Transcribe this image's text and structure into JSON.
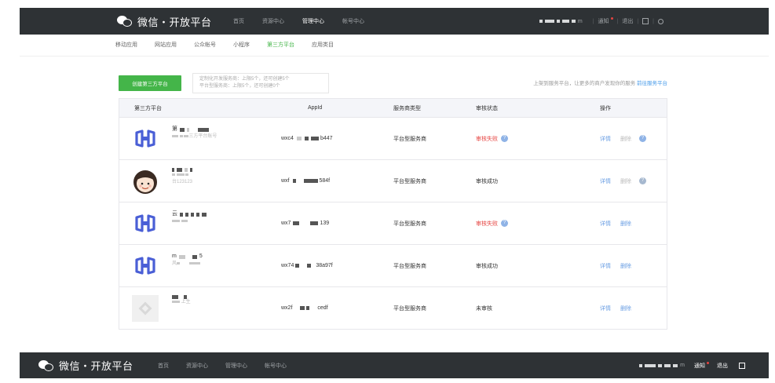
{
  "header": {
    "logo_text": "微信・开放平台",
    "nav": [
      "首页",
      "资源中心",
      "管理中心",
      "帐号中心"
    ],
    "active_nav": "管理中心",
    "account_suffix": "m",
    "notify": "通知",
    "logout": "退出"
  },
  "subnav": {
    "items": [
      "移动应用",
      "网站应用",
      "公众帐号",
      "小程序",
      "第三方平台",
      "应用类目"
    ],
    "active": "第三方平台"
  },
  "actions": {
    "create_button": "创建第三方平台",
    "quota_line1": "定制化开发服务商：上限5个，还可创建5个",
    "quota_line2": "平台型服务商：上限5个，还可创建0个",
    "notice_text": "上架到服务平台，让更多的商户发现你的服务",
    "notice_link": "前往服务平台"
  },
  "table": {
    "headers": {
      "platform": "第三方平台",
      "appid": "AppId",
      "type": "服务商类型",
      "status": "审核状态",
      "op": "操作"
    },
    "rows": [
      {
        "name": "第",
        "desc": "三方平台账号",
        "appid": "wxc4",
        "appid_tail": "b447",
        "type": "平台型服务商",
        "status": "审核失败",
        "status_type": "fail",
        "op_detail": "详情",
        "op_delete": "删除",
        "avatar": "bracket-logo",
        "delete_enabled": false
      },
      {
        "name": "",
        "desc": "台123123",
        "appid": "wxf",
        "appid_tail": "584f",
        "type": "平台型服务商",
        "status": "审核成功",
        "status_type": "ok",
        "op_detail": "详情",
        "op_delete": "删除",
        "avatar": "cartoon-face",
        "delete_enabled": false
      },
      {
        "name": "云",
        "desc": "",
        "appid": "wx7",
        "appid_tail": "139",
        "type": "平台型服务商",
        "status": "审核失败",
        "status_type": "fail",
        "op_detail": "详情",
        "op_delete": "删除",
        "avatar": "bracket-logo",
        "delete_enabled": true
      },
      {
        "name": "m",
        "name_tail": "5",
        "desc": "风",
        "appid": "wx74",
        "appid_tail": "38a97f",
        "type": "平台型服务商",
        "status": "审核成功",
        "status_type": "ok",
        "op_detail": "详情",
        "op_delete": "删除",
        "avatar": "bracket-logo",
        "delete_enabled": true
      },
      {
        "name": "",
        "desc": "上生",
        "appid": "wx2f",
        "appid_tail": "cedf",
        "type": "平台型服务商",
        "status": "未审核",
        "status_type": "none",
        "op_detail": "详情",
        "op_delete": "删除",
        "avatar": "placeholder",
        "delete_enabled": true
      }
    ]
  },
  "footer": {
    "logo_text": "微信・开放平台",
    "nav": [
      "首页",
      "资源中心",
      "管理中心",
      "帐号中心"
    ],
    "account_suffix": "m",
    "notify": "通知",
    "logout": "退出"
  },
  "colors": {
    "header_bg": "#2e3235",
    "accent_green": "#44b549",
    "link_blue": "#459ae9",
    "fail_red": "#e64340"
  }
}
